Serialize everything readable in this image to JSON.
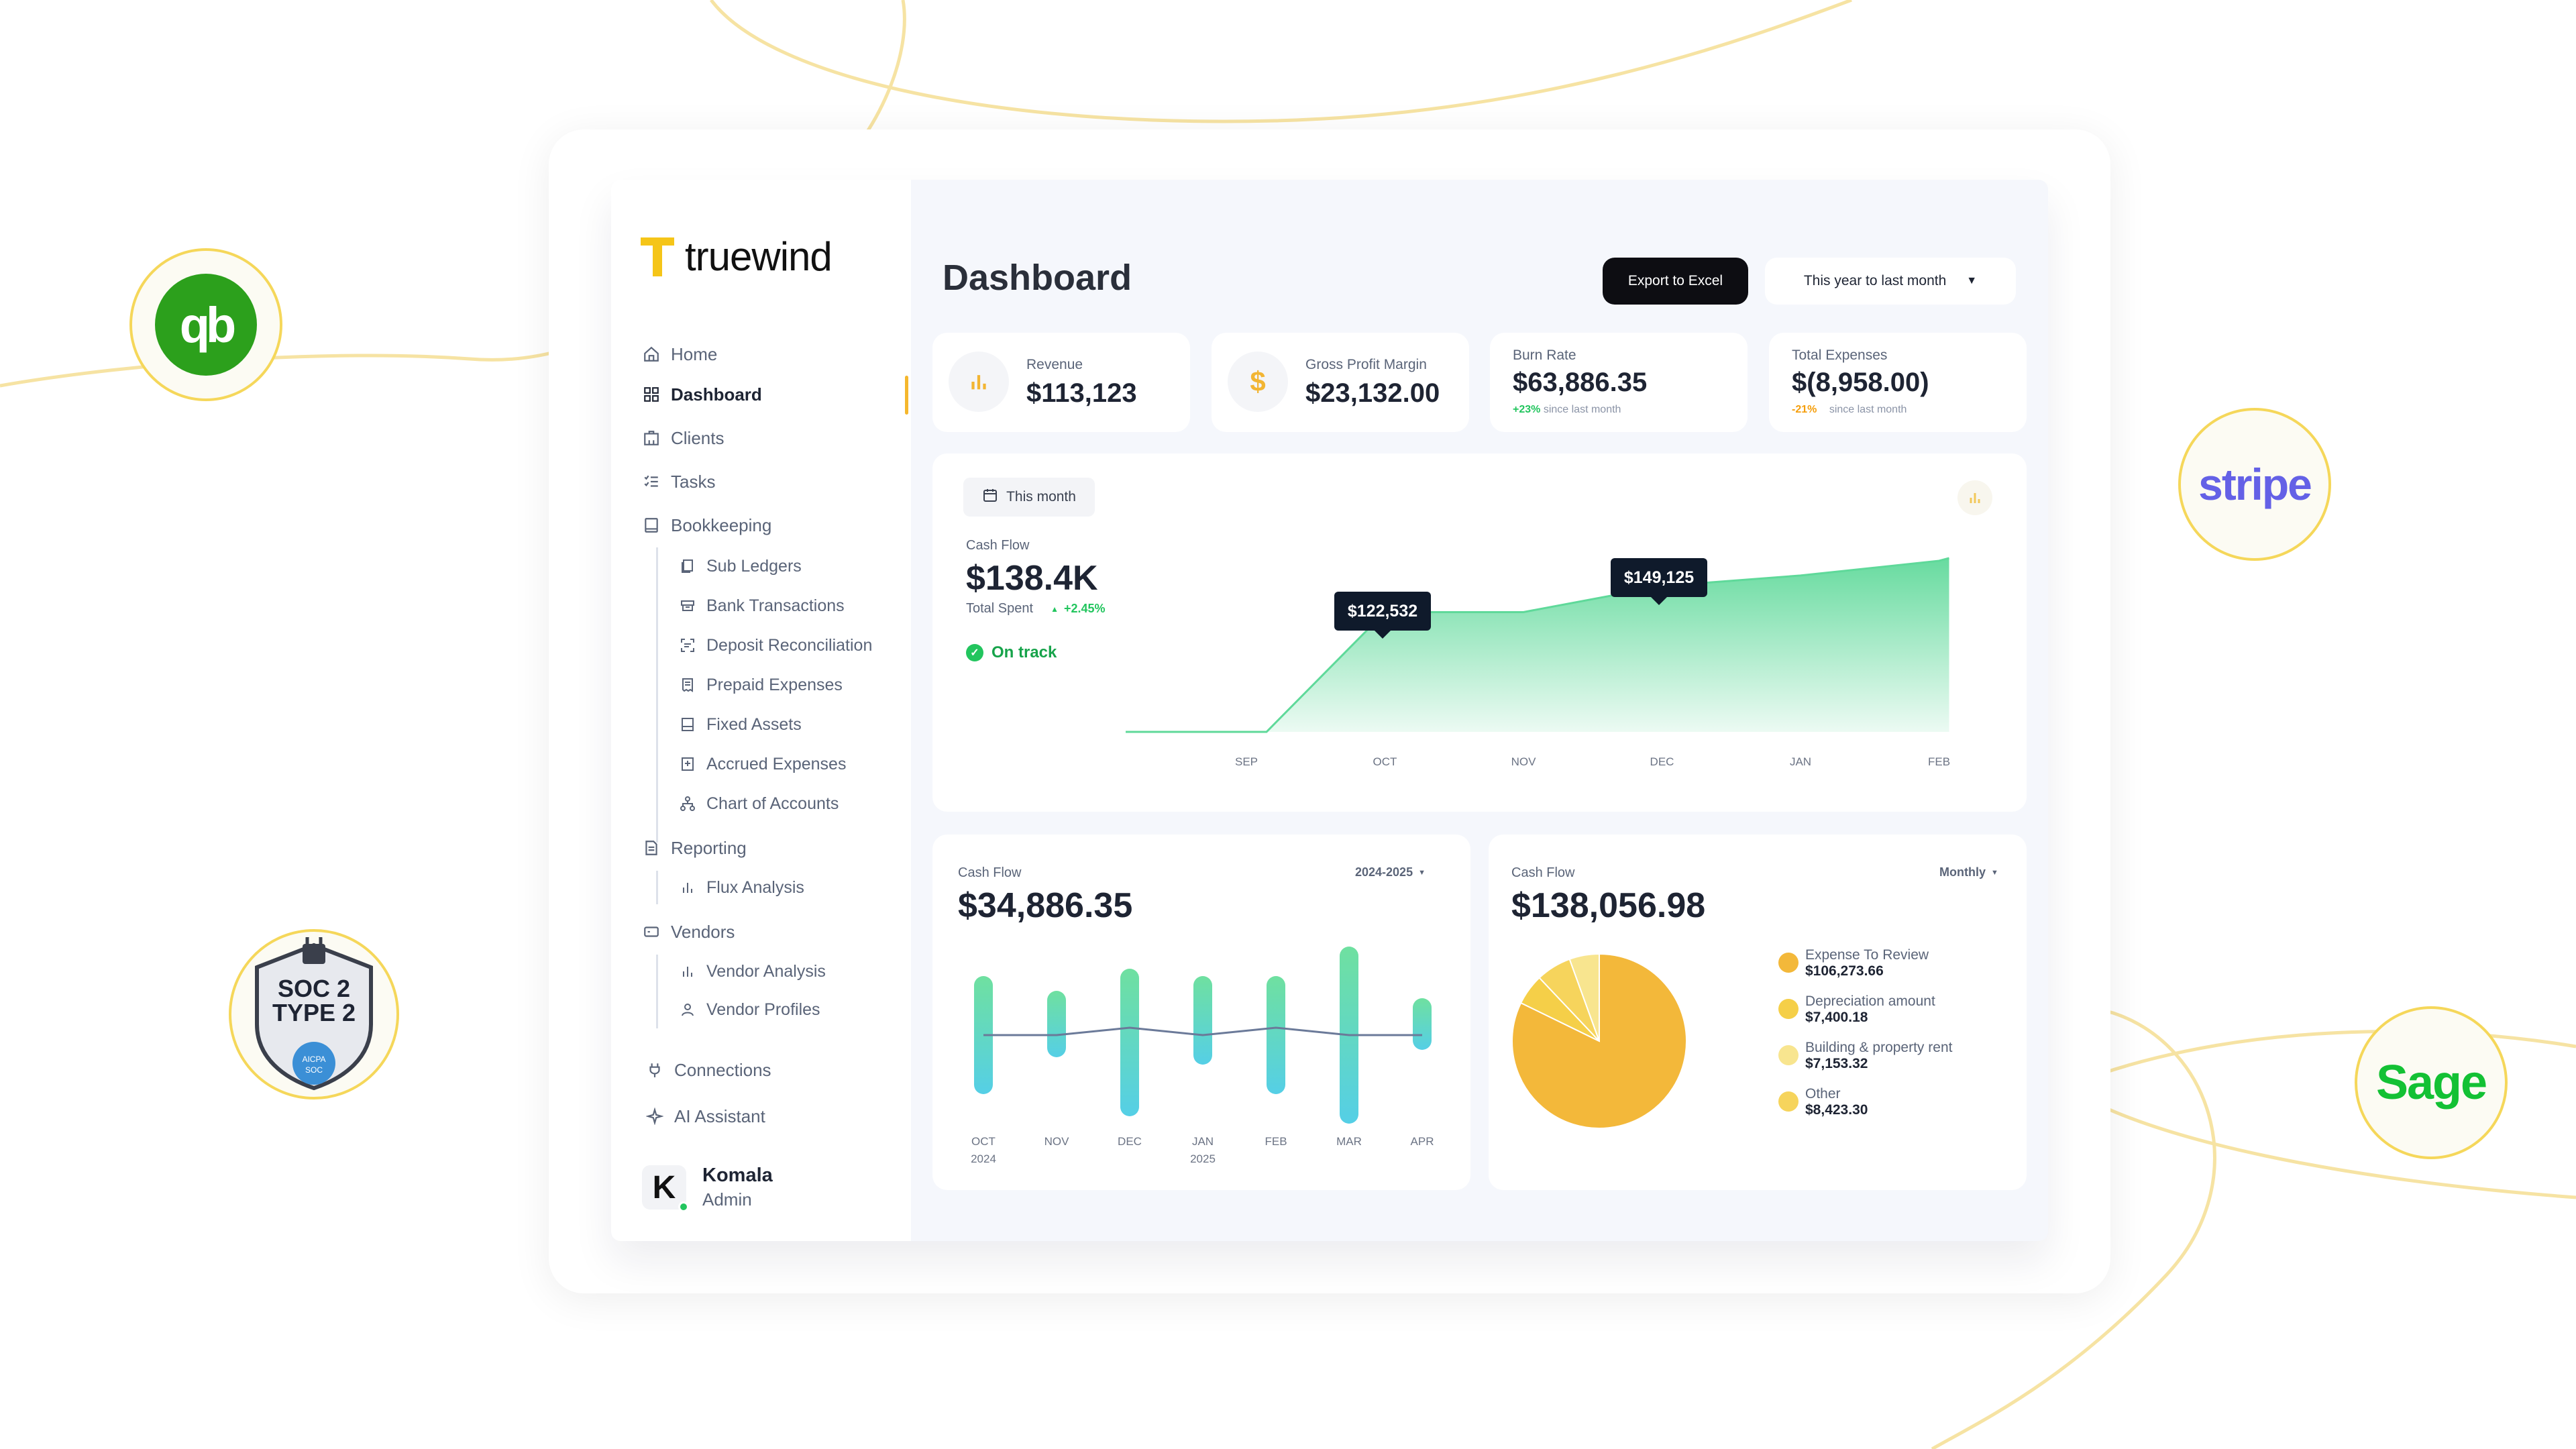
{
  "brand": {
    "name": "truewind",
    "accent": "#f5c518"
  },
  "badges": {
    "quickbooks": "qb",
    "soc_line1": "SOC 2",
    "soc_line2": "TYPE 2",
    "soc_seal_line1": "AICPA",
    "soc_seal_line2": "SOC",
    "stripe": "stripe",
    "sage": "Sage"
  },
  "sidebar": {
    "items": [
      {
        "label": "Home",
        "icon": "home-icon"
      },
      {
        "label": "Dashboard",
        "icon": "grid-icon"
      },
      {
        "label": "Clients",
        "icon": "building-icon"
      },
      {
        "label": "Tasks",
        "icon": "checklist-icon"
      },
      {
        "label": "Bookkeeping",
        "icon": "book-icon"
      },
      {
        "label": "Reporting",
        "icon": "report-icon"
      },
      {
        "label": "Vendors",
        "icon": "card-icon"
      },
      {
        "label": "Connections",
        "icon": "plug-icon"
      },
      {
        "label": "AI Assistant",
        "icon": "sparkle-icon"
      }
    ],
    "bookkeeping_sub": [
      {
        "label": "Sub Ledgers",
        "icon": "ledger-icon"
      },
      {
        "label": "Bank Transactions",
        "icon": "bank-icon"
      },
      {
        "label": "Deposit Reconciliation",
        "icon": "scan-icon"
      },
      {
        "label": "Prepaid Expenses",
        "icon": "receipt-icon"
      },
      {
        "label": "Fixed Assets",
        "icon": "asset-icon"
      },
      {
        "label": "Accrued Expenses",
        "icon": "accrued-icon"
      },
      {
        "label": "Chart of Accounts",
        "icon": "hierarchy-icon"
      }
    ],
    "reporting_sub": [
      {
        "label": "Flux Analysis",
        "icon": "bar-chart-icon"
      }
    ],
    "vendors_sub": [
      {
        "label": "Vendor Analysis",
        "icon": "bar-chart-icon"
      },
      {
        "label": "Vendor Profiles",
        "icon": "user-icon"
      }
    ],
    "user": {
      "initial": "K",
      "name": "Komala",
      "role": "Admin",
      "status_color": "#22c55e"
    }
  },
  "header": {
    "title": "Dashboard",
    "export_label": "Export to Excel",
    "range_label": "This year to last month"
  },
  "kpis": [
    {
      "label": "Revenue",
      "value": "$113,123",
      "icon": "bar-chart-icon"
    },
    {
      "label": "Gross Profit Margin",
      "value": "$23,132.00",
      "icon": "dollar-icon"
    },
    {
      "label": "Burn Rate",
      "value": "$63,886.35",
      "change": "+23%",
      "change_note": "since last month",
      "change_color": "#22c55e"
    },
    {
      "label": "Total Expenses",
      "value": "$(8,958.00)",
      "change": "-21%",
      "change_note": "since last month",
      "change_color": "#f59e0b"
    }
  ],
  "cashflow_main": {
    "period_label": "This month",
    "label": "Cash Flow",
    "value": "$138.4K",
    "sub_label": "Total Spent",
    "change": "+2.45%",
    "status": "On track",
    "tooltips": [
      "$122,532",
      "$149,125"
    ],
    "chart_data": {
      "type": "area",
      "categories": [
        "SEP",
        "OCT",
        "NOV",
        "DEC",
        "JAN",
        "FEB"
      ],
      "values": [
        0,
        122532,
        122532,
        149125,
        160000,
        175000
      ],
      "color": "#5fd99a"
    }
  },
  "cashflow_bars": {
    "label": "Cash Flow",
    "value": "$34,886.35",
    "period": "2024-2025",
    "chart_data": {
      "type": "bar",
      "categories": [
        "OCT",
        "NOV",
        "DEC",
        "JAN",
        "FEB",
        "MAR",
        "APR"
      ],
      "sublabels": [
        "2024",
        "",
        "",
        "2025",
        "",
        "",
        ""
      ],
      "ranges": [
        [
          0.15,
          0.95
        ],
        [
          0.4,
          0.85
        ],
        [
          0.0,
          1.0
        ],
        [
          0.35,
          0.95
        ],
        [
          0.15,
          0.95
        ],
        [
          -0.05,
          1.15
        ],
        [
          0.45,
          0.8
        ]
      ],
      "line": [
        0.55,
        0.55,
        0.6,
        0.55,
        0.6,
        0.55,
        0.55
      ],
      "line_color": "#6b7a99"
    }
  },
  "cashflow_pie": {
    "label": "Cash Flow",
    "value": "$138,056.98",
    "period": "Monthly",
    "chart_data": {
      "type": "pie",
      "slices": [
        {
          "name": "Expense To Review",
          "value": "$106,273.66",
          "amount": 106273.66,
          "color": "#f3b83a"
        },
        {
          "name": "Depreciation amount",
          "value": "$7,400.18",
          "amount": 7400.18,
          "color": "#f5cf48"
        },
        {
          "name": "Building & property rent",
          "value": "$7,153.32",
          "amount": 7153.32,
          "color": "#f8e58f"
        },
        {
          "name": "Other",
          "value": "$8,423.30",
          "amount": 8423.3,
          "color": "#f6d45c"
        }
      ]
    }
  }
}
